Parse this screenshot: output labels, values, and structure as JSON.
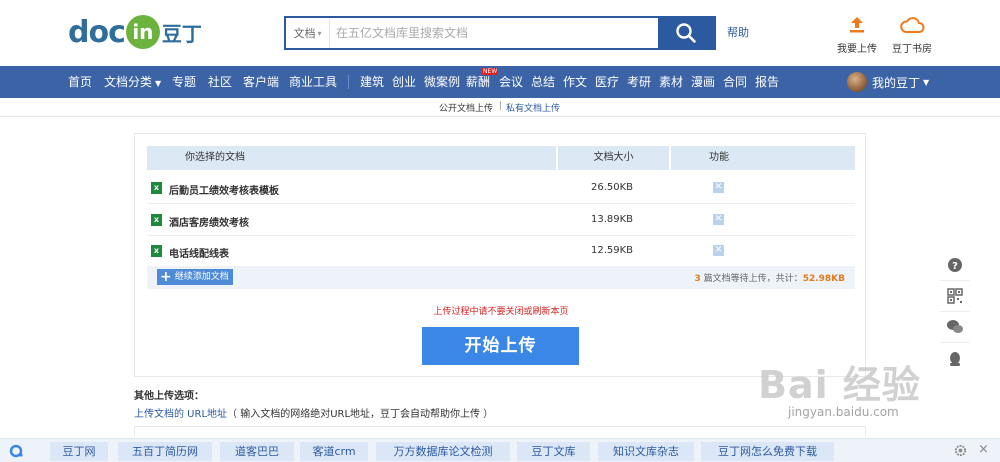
{
  "header": {
    "logo": {
      "doc": "doc",
      "in": "in",
      "cn": "豆丁"
    },
    "search": {
      "type_label": "文档",
      "placeholder": "在五亿文档库里搜索文档"
    },
    "help": "帮助",
    "upload_label": "我要上传",
    "bookshelf_label": "豆丁书房"
  },
  "nav": {
    "items": [
      "首页",
      "文档分类",
      "专题",
      "社区",
      "客户端",
      "商业工具",
      "建筑",
      "创业",
      "微案例",
      "薪酬",
      "会议",
      "总结",
      "作文",
      "医疗",
      "考研",
      "素材",
      "漫画",
      "合同",
      "报告"
    ],
    "new_badge": "NEW",
    "user_label": "我的豆丁"
  },
  "subnav": {
    "public_upload": "公开文档上传",
    "separator": "|",
    "private_upload": "私有文档上传"
  },
  "upload": {
    "headers": {
      "name": "你选择的文档",
      "size": "文档大小",
      "action": "功能"
    },
    "files": [
      {
        "name": "后勤员工绩效考核表模板",
        "size": "26.50KB"
      },
      {
        "name": "酒店客房绩效考核",
        "size": "13.89KB"
      },
      {
        "name": "电话线配线表",
        "size": "12.59KB"
      }
    ],
    "add_more": "继续添加文档",
    "summary_count": "3",
    "summary_middle": "篇文档等待上传，共计：",
    "summary_total": "52.98KB",
    "warning": "上传过程中请不要关闭或刷新本页",
    "start_button": "开始上传"
  },
  "other_options": {
    "title": "其他上传选项：",
    "url_link": "上传文档的 URL地址",
    "url_desc": "（ 输入文档的网络绝对URL地址，豆丁会自动帮助你上传 ）"
  },
  "watermark": {
    "text": "Bai 经验",
    "url": "jingyan.baidu.com"
  },
  "bottom_links": [
    "豆丁网",
    "五百丁简历网",
    "道客巴巴",
    "客道crm",
    "万方数据库论文检测",
    "豆丁文库",
    "知识文库杂志",
    "豆丁网怎么免费下载"
  ],
  "colors": {
    "brand_blue": "#3b63a6",
    "search_blue": "#2c5aa0",
    "start_button": "#3a87e8",
    "warning_red": "#d61f1f",
    "accent_orange": "#e27b1e"
  }
}
